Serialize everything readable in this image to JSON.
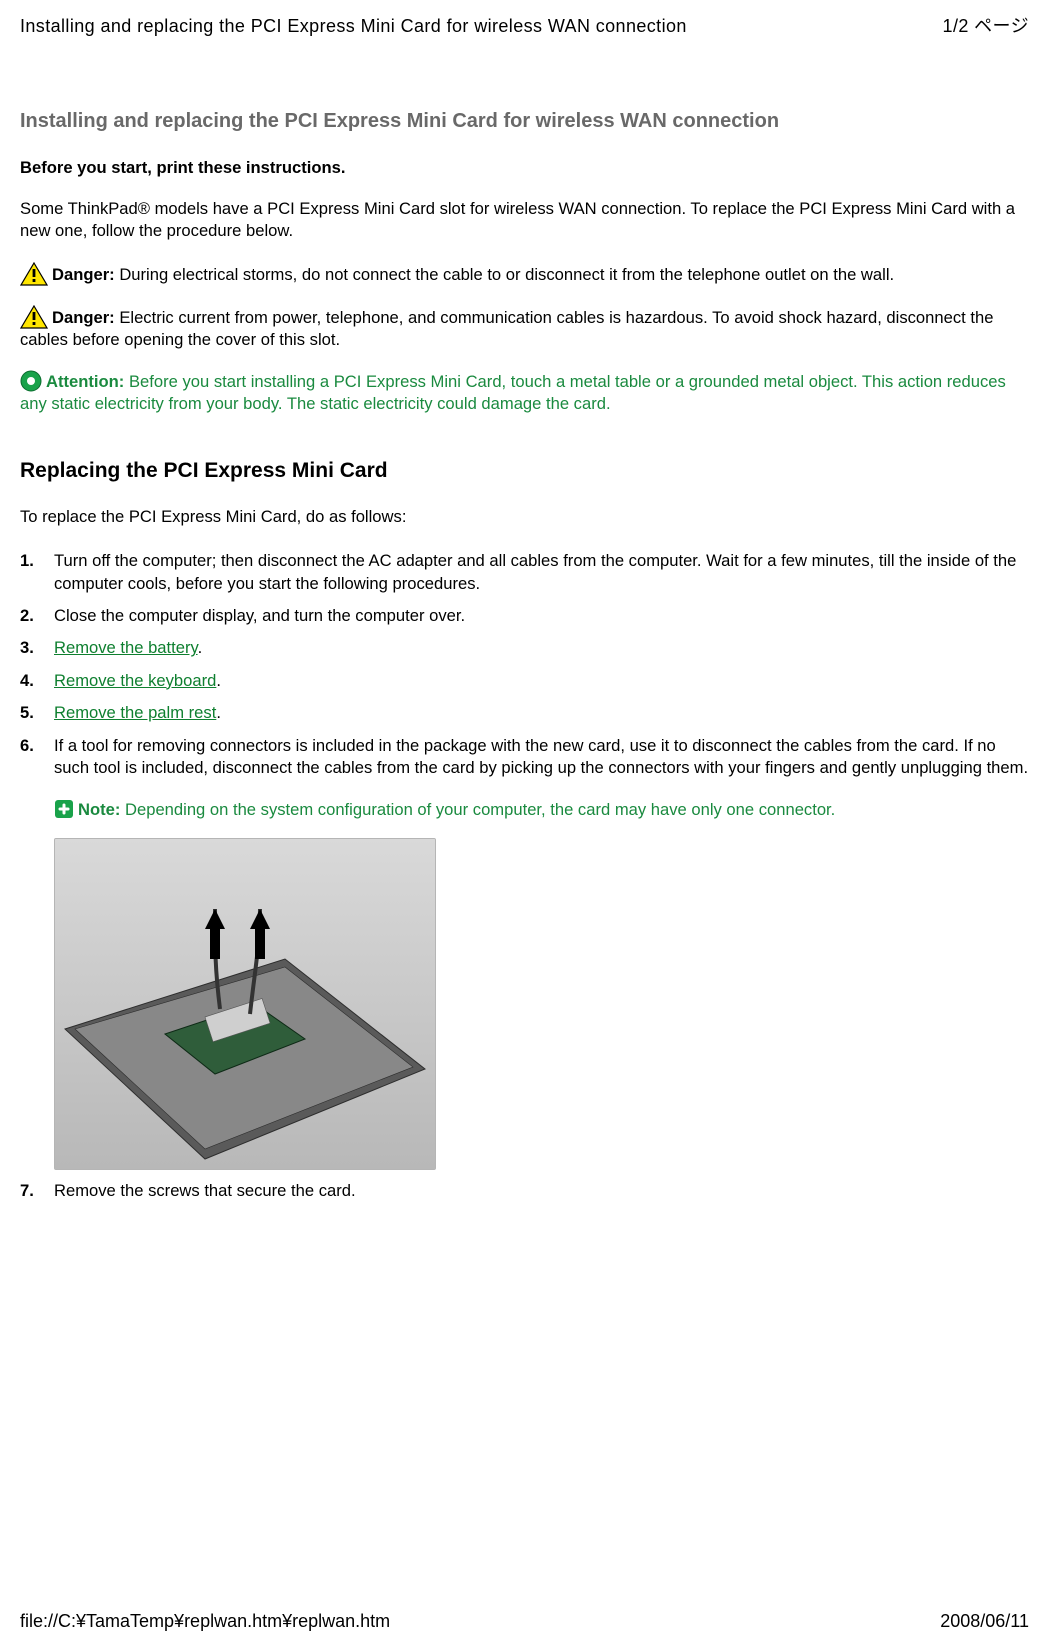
{
  "header": {
    "doc_title": "Installing and replacing the PCI Express Mini Card for wireless WAN connection",
    "page_indicator": "1/2 ページ"
  },
  "title": "Installing and replacing the PCI Express Mini Card for wireless WAN connection",
  "preface": {
    "bold_instruction": "Before you start, print these instructions.",
    "intro_paragraph": "Some ThinkPad® models have a PCI Express Mini Card slot for wireless WAN connection. To replace the PCI Express Mini Card with a new one, follow the procedure below."
  },
  "callouts": [
    {
      "icon": "danger-icon",
      "label": "Danger:",
      "text": " During electrical storms, do not connect the cable to or disconnect it from the telephone outlet on the wall.",
      "style": "danger"
    },
    {
      "icon": "danger-icon",
      "label": "Danger:",
      "text": " Electric current from power, telephone, and communication cables is hazardous. To avoid shock hazard, disconnect the cables before opening the cover of this slot.",
      "style": "danger"
    },
    {
      "icon": "attention-icon",
      "label": "Attention:",
      "text": " Before you start installing a PCI Express Mini Card, touch a metal table or a grounded metal object. This action reduces any static electricity from your body. The static electricity could damage the card.",
      "style": "attention"
    }
  ],
  "section": {
    "heading": "Replacing the PCI Express Mini Card",
    "intro": "To replace the PCI Express Mini Card, do as follows:"
  },
  "steps": [
    {
      "num": "1.",
      "html": "Turn off the computer; then disconnect the AC adapter and all cables from the computer. Wait for a few minutes, till the inside of the computer cools, before you start the following procedures."
    },
    {
      "num": "2.",
      "html": "Close the computer display, and turn the computer over."
    },
    {
      "num": "3.",
      "link": "Remove the battery",
      "tail": "."
    },
    {
      "num": "4.",
      "link": "Remove the keyboard",
      "tail": "."
    },
    {
      "num": "5.",
      "link": "Remove the palm rest",
      "tail": "."
    },
    {
      "num": "6.",
      "html": "If a tool for removing connectors is included in the package with the new card, use it to disconnect the cables from the card. If no such tool is included, disconnect the cables from the card by picking up the connectors with your fingers and gently unplugging them.",
      "note": {
        "icon": "note-icon",
        "label": "Note:",
        "text": " Depending on the system configuration of your computer, the card may have only one connector."
      },
      "figure": true
    },
    {
      "num": "7.",
      "html": "Remove the screws that secure the card."
    }
  ],
  "footer": {
    "path": "file://C:¥TamaTemp¥replwan.htm¥replwan.htm",
    "date": "2008/06/11"
  }
}
